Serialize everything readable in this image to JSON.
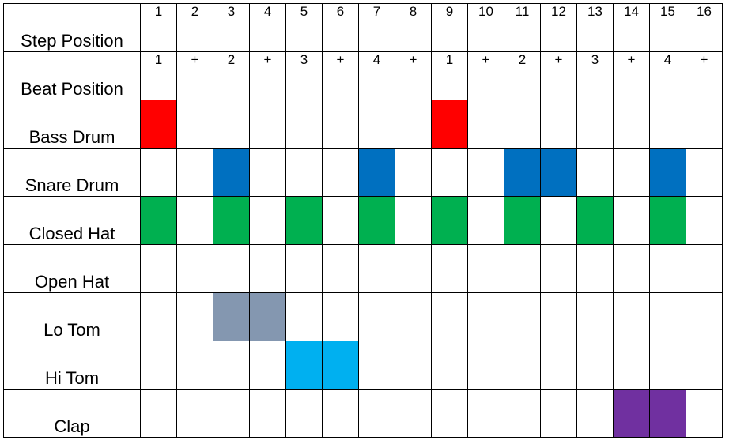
{
  "header_rows": [
    {
      "label": "Step Position",
      "values": [
        "1",
        "2",
        "3",
        "4",
        "5",
        "6",
        "7",
        "8",
        "9",
        "10",
        "11",
        "12",
        "13",
        "14",
        "15",
        "16"
      ]
    },
    {
      "label": "Beat Position",
      "values": [
        "1",
        "+",
        "2",
        "+",
        "3",
        "+",
        "4",
        "+",
        "1",
        "+",
        "2",
        "+",
        "3",
        "+",
        "4",
        "+"
      ]
    }
  ],
  "tracks": [
    {
      "label": "Bass Drum",
      "color": "#FF0000",
      "steps": [
        1,
        0,
        0,
        0,
        0,
        0,
        0,
        0,
        1,
        0,
        0,
        0,
        0,
        0,
        0,
        0
      ]
    },
    {
      "label": "Snare Drum",
      "color": "#0070C0",
      "steps": [
        0,
        0,
        1,
        0,
        0,
        0,
        1,
        0,
        0,
        0,
        1,
        1,
        0,
        0,
        1,
        0
      ]
    },
    {
      "label": "Closed Hat",
      "color": "#00B050",
      "steps": [
        1,
        0,
        1,
        0,
        1,
        0,
        1,
        0,
        1,
        0,
        1,
        0,
        1,
        0,
        1,
        0
      ]
    },
    {
      "label": "Open Hat",
      "color": "#000000",
      "steps": [
        0,
        0,
        0,
        0,
        0,
        0,
        0,
        0,
        0,
        0,
        0,
        0,
        0,
        0,
        0,
        0
      ]
    },
    {
      "label": "Lo Tom",
      "color": "#8497B0",
      "steps": [
        0,
        0,
        1,
        1,
        0,
        0,
        0,
        0,
        0,
        0,
        0,
        0,
        0,
        0,
        0,
        0
      ]
    },
    {
      "label": "Hi Tom",
      "color": "#00B0F0",
      "steps": [
        0,
        0,
        0,
        0,
        1,
        1,
        0,
        0,
        0,
        0,
        0,
        0,
        0,
        0,
        0,
        0
      ]
    },
    {
      "label": "Clap",
      "color": "#7030A0",
      "steps": [
        0,
        0,
        0,
        0,
        0,
        0,
        0,
        0,
        0,
        0,
        0,
        0,
        0,
        1,
        1,
        0
      ]
    }
  ]
}
